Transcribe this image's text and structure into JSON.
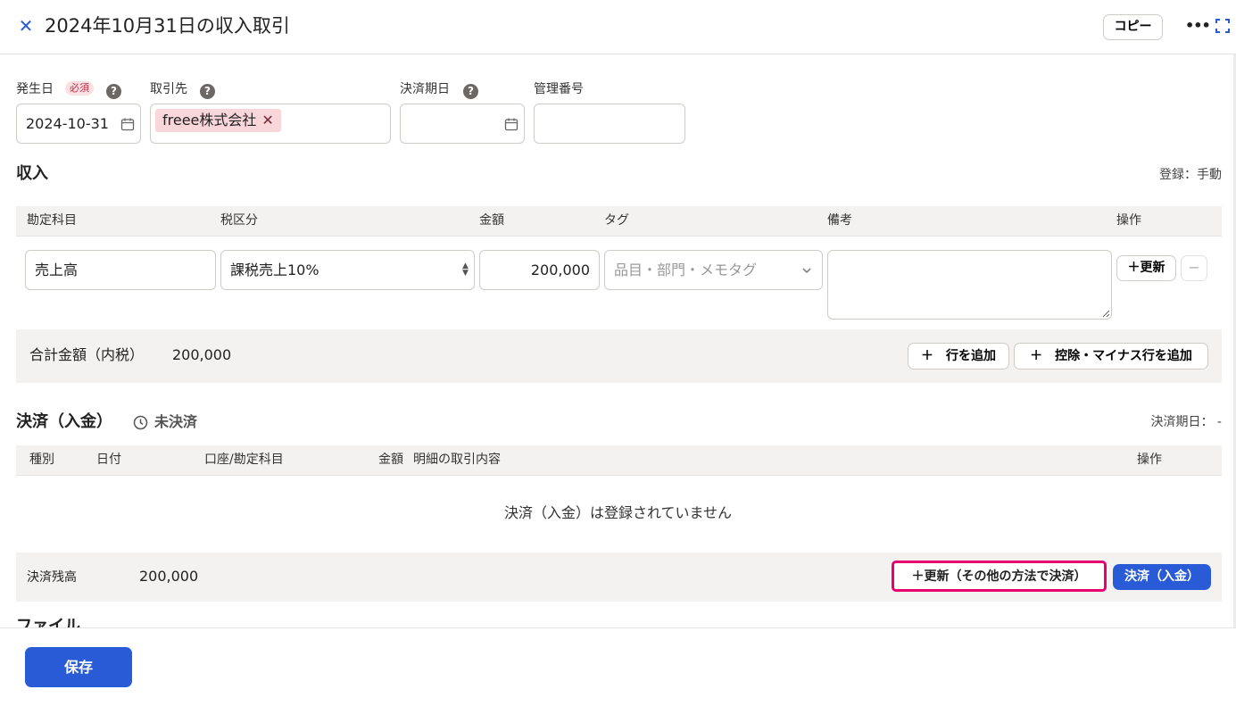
{
  "header": {
    "title": "2024年10月31日の収入取引",
    "copy_label": "コピー",
    "more_label": "•••"
  },
  "fields": {
    "issue_date": {
      "label": "発生日",
      "required": "必須",
      "value": "2024-10-31"
    },
    "partner": {
      "label": "取引先",
      "chip": "freee株式会社",
      "chip_remove": "✕"
    },
    "due_date": {
      "label": "決済期日",
      "value": ""
    },
    "ref_number": {
      "label": "管理番号",
      "value": ""
    },
    "help_glyph": "?"
  },
  "income": {
    "title": "収入",
    "registration": "登録：手動",
    "columns": [
      "勘定科目",
      "税区分",
      "金額",
      "タグ",
      "備考",
      "操作"
    ],
    "row": {
      "account": "売上高",
      "tax": "課税売上10%",
      "amount": "200,000",
      "tag_placeholder": "品目・部門・メモタグ",
      "memo": "",
      "update_label": "＋更新",
      "remove_label": "−"
    },
    "total_label": "合計金額（内税）",
    "total_value": "200,000",
    "add_row_label": "＋　行を追加",
    "add_deduction_label": "＋　控除・マイナス行を追加"
  },
  "settlement": {
    "title": "決済（入金）",
    "status": "未決済",
    "due_note": "決済期日：  -",
    "columns": [
      "種別",
      "日付",
      "口座/勘定科目",
      "金額",
      "明細の取引内容",
      "操作"
    ],
    "empty_message": "決済（入金）は登録されていません",
    "balance_label": "決済残高",
    "balance_value": "200,000",
    "other_method_label": "＋更新（その他の方法で決済）",
    "pay_label": "決済（入金）"
  },
  "next_section_partial": "ファイル",
  "footer": {
    "save_label": "保存"
  },
  "colors": {
    "accent": "#2a5bd7",
    "highlight": "#e8006f",
    "chip": "#f9d6d9",
    "required_badge": "#fbe1e3"
  }
}
